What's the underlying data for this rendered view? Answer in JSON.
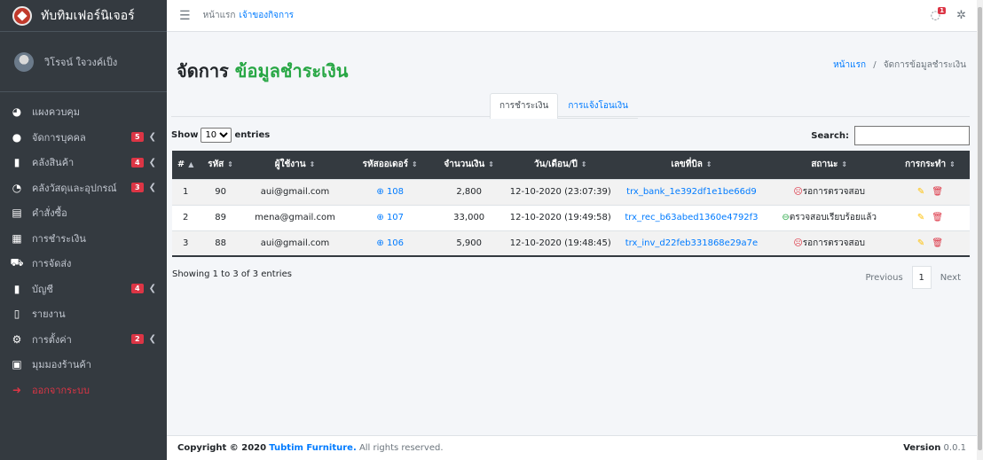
{
  "brand": {
    "name": "ทับทิมเฟอร์นิเจอร์"
  },
  "user": {
    "name": "วิโรจน์ ใจวงค์เป็ง"
  },
  "sidebar": {
    "items": [
      {
        "label": "แผงควบคุม",
        "icon": "tachometer-icon",
        "badge": null,
        "chevron": false
      },
      {
        "label": "จัดการบุคคล",
        "icon": "user-circle-icon",
        "badge": "5",
        "chevron": true
      },
      {
        "label": "คลังสินค้า",
        "icon": "boxes-icon",
        "badge": "4",
        "chevron": true
      },
      {
        "label": "คลังวัสดุและอุปกรณ์",
        "icon": "pie-chart-icon",
        "badge": "3",
        "chevron": true
      },
      {
        "label": "คำสั่งซื้อ",
        "icon": "list-icon",
        "badge": null,
        "chevron": false
      },
      {
        "label": "การชำระเงิน",
        "icon": "cash-register-icon",
        "badge": null,
        "chevron": false
      },
      {
        "label": "การจัดส่ง",
        "icon": "truck-icon",
        "badge": null,
        "chevron": false
      },
      {
        "label": "บัญชี",
        "icon": "book-icon",
        "badge": "4",
        "chevron": true
      },
      {
        "label": "รายงาน",
        "icon": "file-icon",
        "badge": null,
        "chevron": false
      },
      {
        "label": "การตั้งค่า",
        "icon": "cogs-icon",
        "badge": "2",
        "chevron": true
      },
      {
        "label": "มุมมองร้านค้า",
        "icon": "store-icon",
        "badge": null,
        "chevron": false
      },
      {
        "label": "ออกจากระบบ",
        "icon": "sign-out-icon",
        "badge": null,
        "chevron": false
      }
    ]
  },
  "navbar": {
    "home": "หน้าแรก",
    "owner": "เจ้าของกิจการ",
    "message_badge": "1"
  },
  "page": {
    "title_prefix": "จัดการ",
    "title_accent": "ข้อมูลชำระเงิน",
    "breadcrumb_home": "หน้าแรก",
    "breadcrumb_sep": "/",
    "breadcrumb_current": "จัดการข้อมูลชำระเงิน"
  },
  "tabs": [
    {
      "label": "การชำระเงิน",
      "active": true
    },
    {
      "label": "การแจ้งโอนเงิน",
      "active": false
    }
  ],
  "table_controls": {
    "show_label": "Show",
    "entries_value": "10",
    "entries_label": "entries",
    "search_label": "Search:"
  },
  "table": {
    "columns": [
      "#",
      "รหัส",
      "ผู้ใช้งาน",
      "รหัสออเดอร์",
      "จำนวนเงิน",
      "วัน/เดือน/ปี",
      "เลขที่บิล",
      "สถานะ",
      "การกระทำ"
    ],
    "rows": [
      {
        "num": "1",
        "id": "90",
        "user": "aui@gmail.com",
        "order": "108",
        "amount": "2,800",
        "date": "12-10-2020 (23:07:39)",
        "bill": "trx_bank_1e392df1e1be66d9",
        "status": "รอการตรวจสอบ",
        "status_type": "pending"
      },
      {
        "num": "2",
        "id": "89",
        "user": "mena@gmail.com",
        "order": "107",
        "amount": "33,000",
        "date": "12-10-2020 (19:49:58)",
        "bill": "trx_rec_b63abed1360e4792f3",
        "status": "ตรวจสอบเรียบร้อยแล้ว",
        "status_type": "ok"
      },
      {
        "num": "3",
        "id": "88",
        "user": "aui@gmail.com",
        "order": "106",
        "amount": "5,900",
        "date": "12-10-2020 (19:48:45)",
        "bill": "trx_inv_d22feb331868e29a7e",
        "status": "รอการตรวจสอบ",
        "status_type": "pending"
      }
    ]
  },
  "table_info": "Showing 1 to 3 of 3 entries",
  "pagination": {
    "previous": "Previous",
    "page": "1",
    "next": "Next"
  },
  "footer": {
    "copyright": "Copyright © 2020",
    "company": "Tubtim Furniture.",
    "rights": "All rights reserved.",
    "version_label": "Version",
    "version": "0.0.1"
  },
  "colors": {
    "sidebar": "#343a40",
    "accent_green": "#28a745",
    "link_blue": "#007bff",
    "badge_red": "#dc3545"
  }
}
